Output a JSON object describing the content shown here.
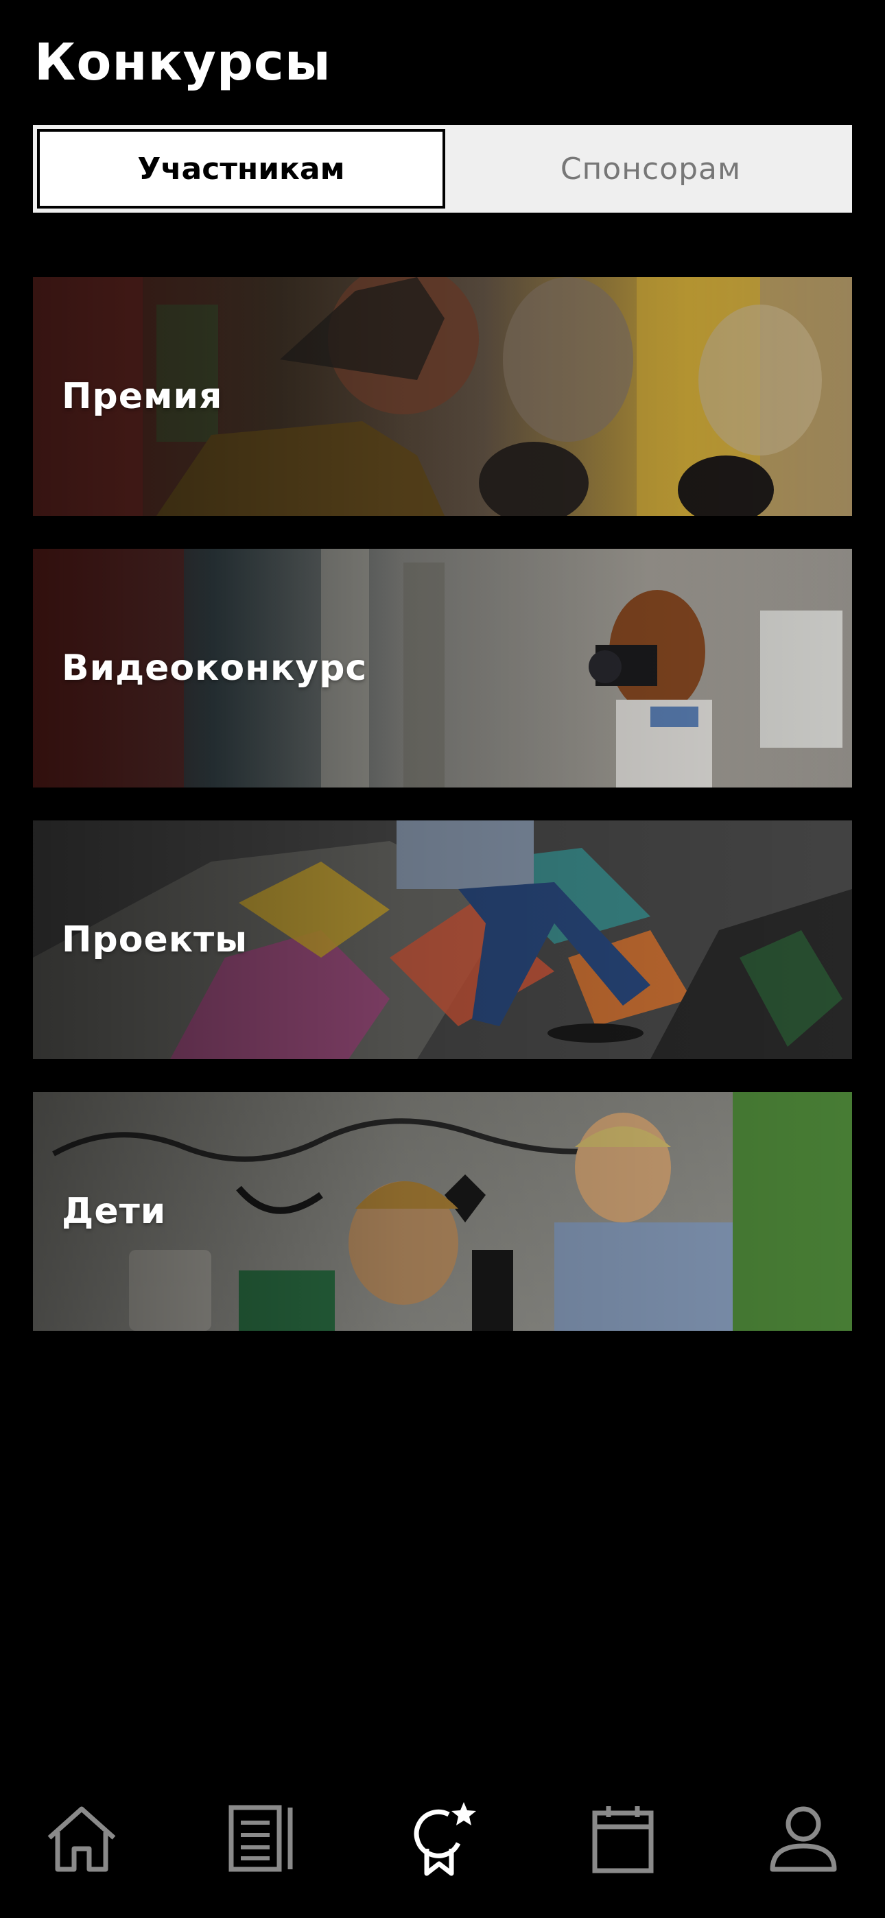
{
  "header": {
    "title": "Конкурсы"
  },
  "segmented": {
    "active_label": "Участникам",
    "inactive_label": "Спонсорам"
  },
  "cards": [
    {
      "label": "Премия",
      "image": "graffiti-wall-teens-photo"
    },
    {
      "label": "Видеоконкурс",
      "image": "photographer-girl-ruins-photo"
    },
    {
      "label": "Проекты",
      "image": "skateboarder-ramp-photo"
    },
    {
      "label": "Дети",
      "image": "kids-graffiti-wall-photo"
    }
  ],
  "bottom_nav": {
    "items": [
      {
        "icon": "home-icon",
        "active": false
      },
      {
        "icon": "news-icon",
        "active": false
      },
      {
        "icon": "contests-award-icon",
        "active": true
      },
      {
        "icon": "calendar-icon",
        "active": false
      },
      {
        "icon": "profile-icon",
        "active": false
      }
    ],
    "colors": {
      "active": "#ffffff",
      "inactive": "#8a8a8a"
    }
  }
}
